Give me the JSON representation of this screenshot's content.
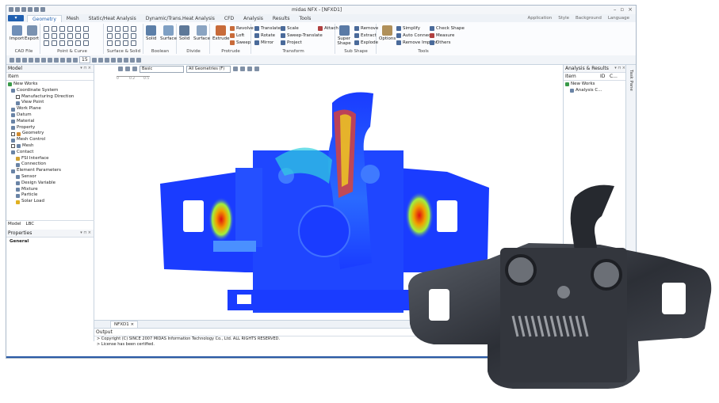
{
  "app": {
    "window_title": "midas NFX - [NFXD1]",
    "file_button": "",
    "menu_tabs": [
      "Geometry",
      "Mesh",
      "Static/Heat Analysis",
      "Dynamic/Trans.Heat Analysis",
      "CFD",
      "Analysis",
      "Results",
      "Tools"
    ],
    "right_menu": [
      "Application",
      "Style",
      "Background",
      "Language"
    ]
  },
  "ribbon": {
    "cad_file": {
      "label": "CAD File",
      "import": "Import",
      "export": "Export"
    },
    "point_curve": {
      "label": "Point & Curve"
    },
    "surface_solid": {
      "label": "Surface & Solid"
    },
    "boolean": {
      "label": "Boolean",
      "solid": "Solid",
      "surface": "Surface"
    },
    "divide": {
      "label": "Divide",
      "solid": "Solid",
      "surface": "Surface"
    },
    "protrude": {
      "label": "Protrude",
      "extrude": "Extrude",
      "revolve": "Revolve",
      "loft": "Loft",
      "sweep": "Sweep"
    },
    "transform": {
      "label": "Transform",
      "translate": "Translate",
      "rotate": "Rotate",
      "mirror": "Mirror",
      "scale": "Scale",
      "sweep_translate": "Sweep-Translate",
      "project": "Project",
      "attach": "Attach"
    },
    "sub_shape": {
      "label": "Sub Shape",
      "super_shape": "Super Shape",
      "remove": "Remove",
      "extract": "Extract",
      "explode": "Explode"
    },
    "tools": {
      "label": "Tools",
      "options": "Options",
      "simplify": "Simplify",
      "auto_connect": "Auto Connect",
      "remove_imprint": "Remove Imprint",
      "check_shape": "Check Shape",
      "measure": "Measure",
      "others": "Others"
    }
  },
  "toolbar": {
    "zoom_value": "15"
  },
  "model_panel": {
    "title": "Model",
    "column": "Item",
    "items": [
      "New Works",
      "Coordinate System",
      "Manufacturing Direction",
      "View Point",
      "Work Plane",
      "Datum",
      "Material",
      "Property",
      "Geometry",
      "Mesh Control",
      "Mesh",
      "Contact",
      "FSI Interface",
      "Connection",
      "Element Parameters",
      "Sensor",
      "Design Variable",
      "Mixture",
      "Particle",
      "Solar Load"
    ],
    "tabs": [
      "Model",
      "LBC"
    ]
  },
  "properties_panel": {
    "title": "Properties",
    "category": "General"
  },
  "viewport": {
    "scale_labels": [
      "0",
      "0.2",
      "0.5"
    ],
    "filter_select": "Basic",
    "geometry_select": "All Geometries (F)"
  },
  "doc_tab": "NFXD1",
  "output": {
    "title": "Output",
    "lines": [
      "> Copyright (C) SINCE 2007 MIDAS Information Technology Co., Ltd. ALL RIGHTS RESERVED.",
      "> License has been certified."
    ]
  },
  "analysis_panel": {
    "title": "Analysis & Results",
    "columns": [
      "Item",
      "ID",
      "C..."
    ],
    "items": [
      "New Works",
      "Analysis C..."
    ]
  },
  "task_pane": "Task Pane",
  "colors": {
    "accent": "#1f5fb0",
    "contour_blue": "#1a3cff",
    "contour_red": "#e01010"
  }
}
